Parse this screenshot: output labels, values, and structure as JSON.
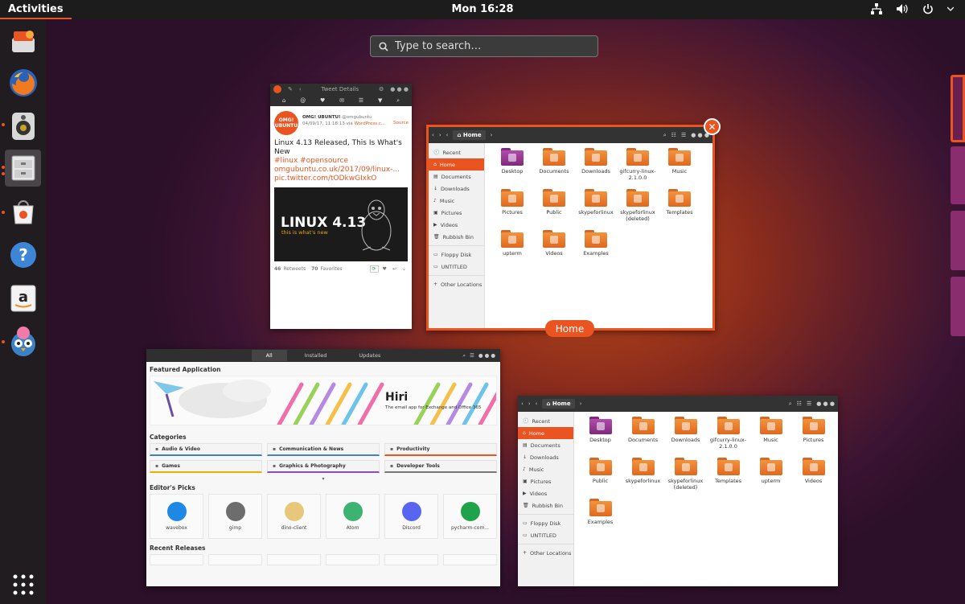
{
  "topbar": {
    "activities": "Activities",
    "clock": "Mon 16:28"
  },
  "search": {
    "placeholder": "Type to search…"
  },
  "colors": {
    "accent": "#e95420",
    "topbar": "#1c1c1c"
  },
  "dock": {
    "items": [
      "files-manager-icon",
      "firefox-icon",
      "rhythmbox-icon",
      "files-icon",
      "software-center-icon",
      "help-icon",
      "amazon-icon",
      "corebird-icon"
    ],
    "grid_icon": "show-applications-icon"
  },
  "tweet_window": {
    "header_title": "Tweet Details",
    "author_name": "OMG! UBUNTU!",
    "author_handle": "@omgubuntu",
    "avatar_text": "OMG! UBUNTU",
    "date_line": "04/09/17, 11:18:13 via",
    "date_link": "WordPress.c...",
    "source_link": "Source",
    "text": "Linux 4.13 Released, This Is What's New",
    "hashtags": "#linux #opensource",
    "link1": "omgubuntu.co.uk/2017/09/linux-...",
    "link2": "pic.twitter.com/tODkwGIxkO",
    "image_title": "LINUX 4.13",
    "image_subtitle": "this is what's new",
    "retweets_count": "46",
    "retweets_label": "Retweets",
    "favorites_count": "70",
    "favorites_label": "Favorites"
  },
  "files_main": {
    "path": "Home",
    "label": "Home",
    "sidebar": [
      "Recent",
      "Home",
      "Documents",
      "Downloads",
      "Music",
      "Pictures",
      "Videos",
      "Rubbish Bin",
      "Floppy Disk",
      "UNTITLED",
      "Other Locations"
    ],
    "files": [
      "Desktop",
      "Documents",
      "Downloads",
      "gifcurry-linux-2.1.0.0",
      "Music",
      "Pictures",
      "Public",
      "skypeforlinux",
      "skypeforlinux (deleted)",
      "Templates",
      "upterm",
      "Videos",
      "Examples"
    ]
  },
  "files_second": {
    "path": "Home",
    "sidebar": [
      "Recent",
      "Home",
      "Documents",
      "Downloads",
      "Music",
      "Pictures",
      "Videos",
      "Rubbish Bin",
      "Floppy Disk",
      "UNTITLED",
      "Other Locations"
    ],
    "files": [
      "Desktop",
      "Documents",
      "Downloads",
      "gifcurry-linux-2.1.0.0",
      "Music",
      "Pictures",
      "Public",
      "skypeforlinux",
      "skypeforlinux (deleted)",
      "Templates",
      "upterm",
      "Videos",
      "Examples"
    ]
  },
  "software": {
    "tabs": [
      "All",
      "Installed",
      "Updates"
    ],
    "featured_title": "Featured Application",
    "banner_name": "Hiri",
    "banner_tagline": "The email app for Exchange and Office 365",
    "categories_title": "Categories",
    "categories": [
      "Audio & Video",
      "Communication & News",
      "Productivity",
      "Games",
      "Graphics & Photography",
      "Developer Tools"
    ],
    "editors_title": "Editor's Picks",
    "picks": [
      "wavebox",
      "gimp",
      "dino-client",
      "Atom",
      "Discord",
      "pycharm-com..."
    ],
    "recent_title": "Recent Releases"
  }
}
